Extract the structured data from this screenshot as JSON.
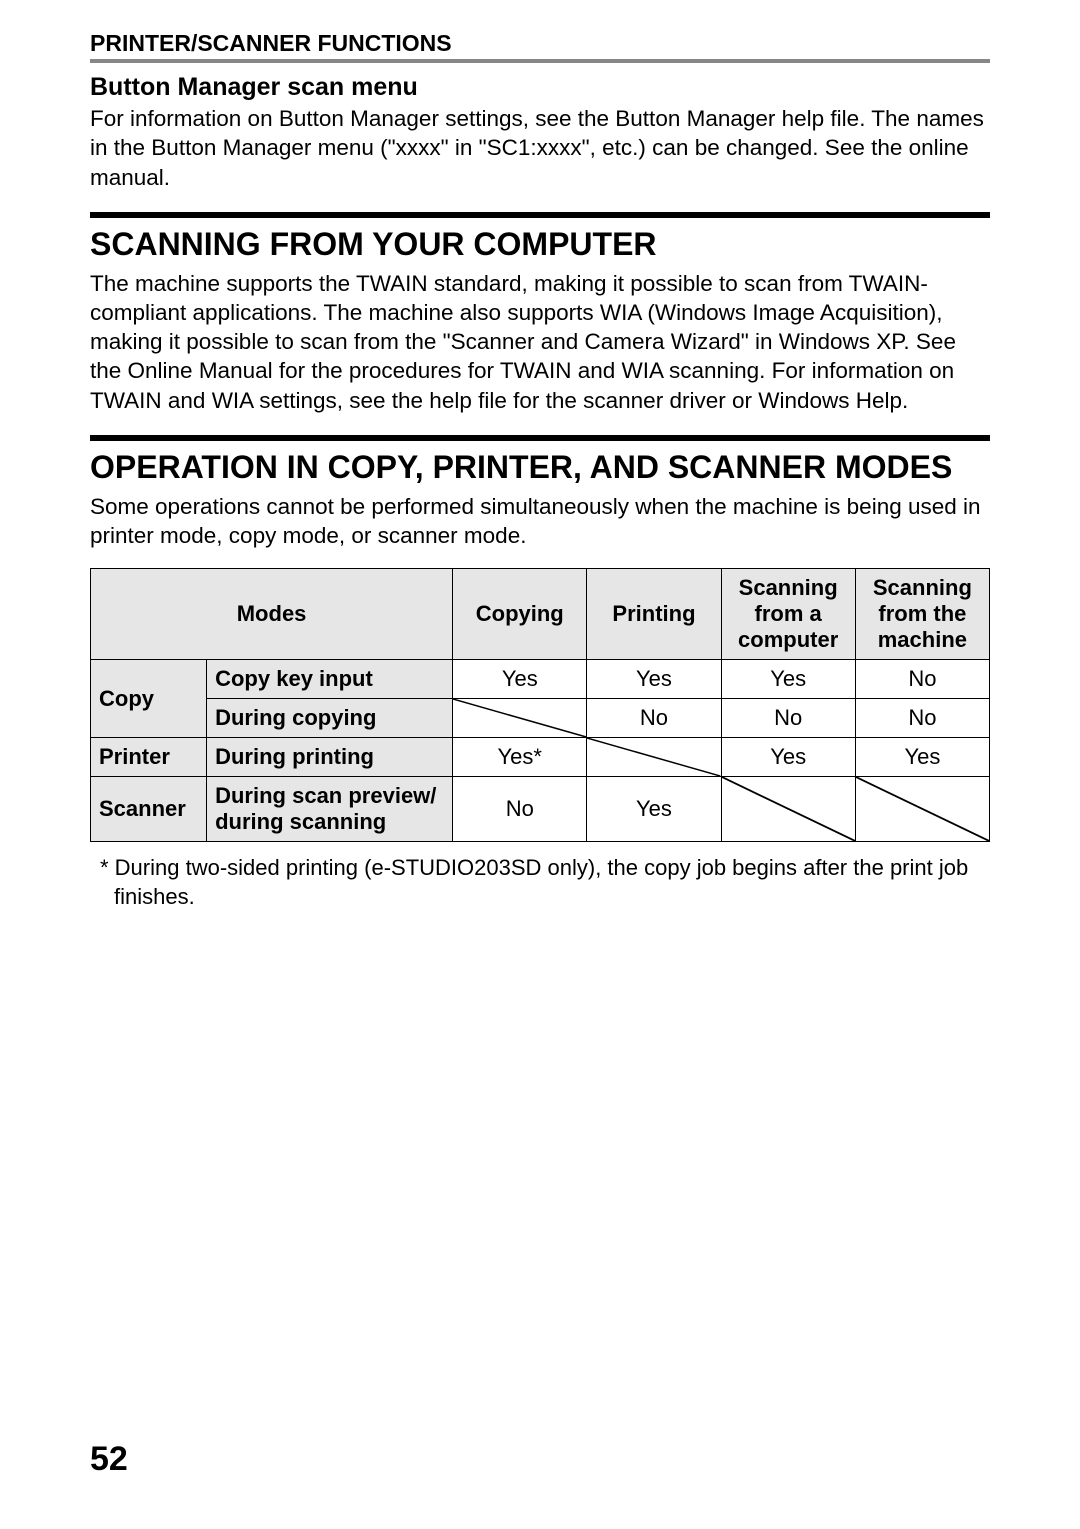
{
  "header": "PRINTER/SCANNER FUNCTIONS",
  "section1": {
    "title": "Button Manager scan menu",
    "body": "For information on Button Manager settings, see the Button Manager help file. The names in the Button Manager menu (\"xxxx\" in \"SC1:xxxx\", etc.) can be changed. See the online manual."
  },
  "section2": {
    "title": "SCANNING FROM YOUR COMPUTER",
    "body": "The machine supports the TWAIN standard, making it possible to scan from TWAIN-compliant applications. The machine also supports WIA (Windows Image Acquisition), making it possible to scan from the \"Scanner and Camera Wizard\" in Windows XP. See the Online Manual for the procedures for TWAIN and WIA scanning. For information on TWAIN and WIA settings, see the help file for the scanner driver or Windows Help."
  },
  "section3": {
    "title": "OPERATION IN COPY, PRINTER, AND SCANNER MODES",
    "body": "Some operations cannot be performed simultaneously when the machine is being used in printer mode, copy mode, or scanner mode."
  },
  "table": {
    "headers": {
      "modes": "Modes",
      "copying": "Copying",
      "printing": "Printing",
      "scan_computer": "Scanning from a computer",
      "scan_machine": "Scanning from the machine"
    },
    "rows": [
      {
        "group": "Copy",
        "state": "Copy key input",
        "copying": "Yes",
        "printing": "Yes",
        "scan_computer": "Yes",
        "scan_machine": "No"
      },
      {
        "group": "",
        "state": "During copying",
        "copying": "",
        "printing": "No",
        "scan_computer": "No",
        "scan_machine": "No"
      },
      {
        "group": "Printer",
        "state": "During printing",
        "copying": "Yes*",
        "printing": "",
        "scan_computer": "Yes",
        "scan_machine": "Yes"
      },
      {
        "group": "Scanner",
        "state": "During scan preview/ during scanning",
        "copying": "No",
        "printing": "Yes",
        "scan_computer": "",
        "scan_machine": ""
      }
    ]
  },
  "footnote": "* During two-sided printing (e-STUDIO203SD only), the copy job begins after the print job finishes.",
  "page_number": "52"
}
